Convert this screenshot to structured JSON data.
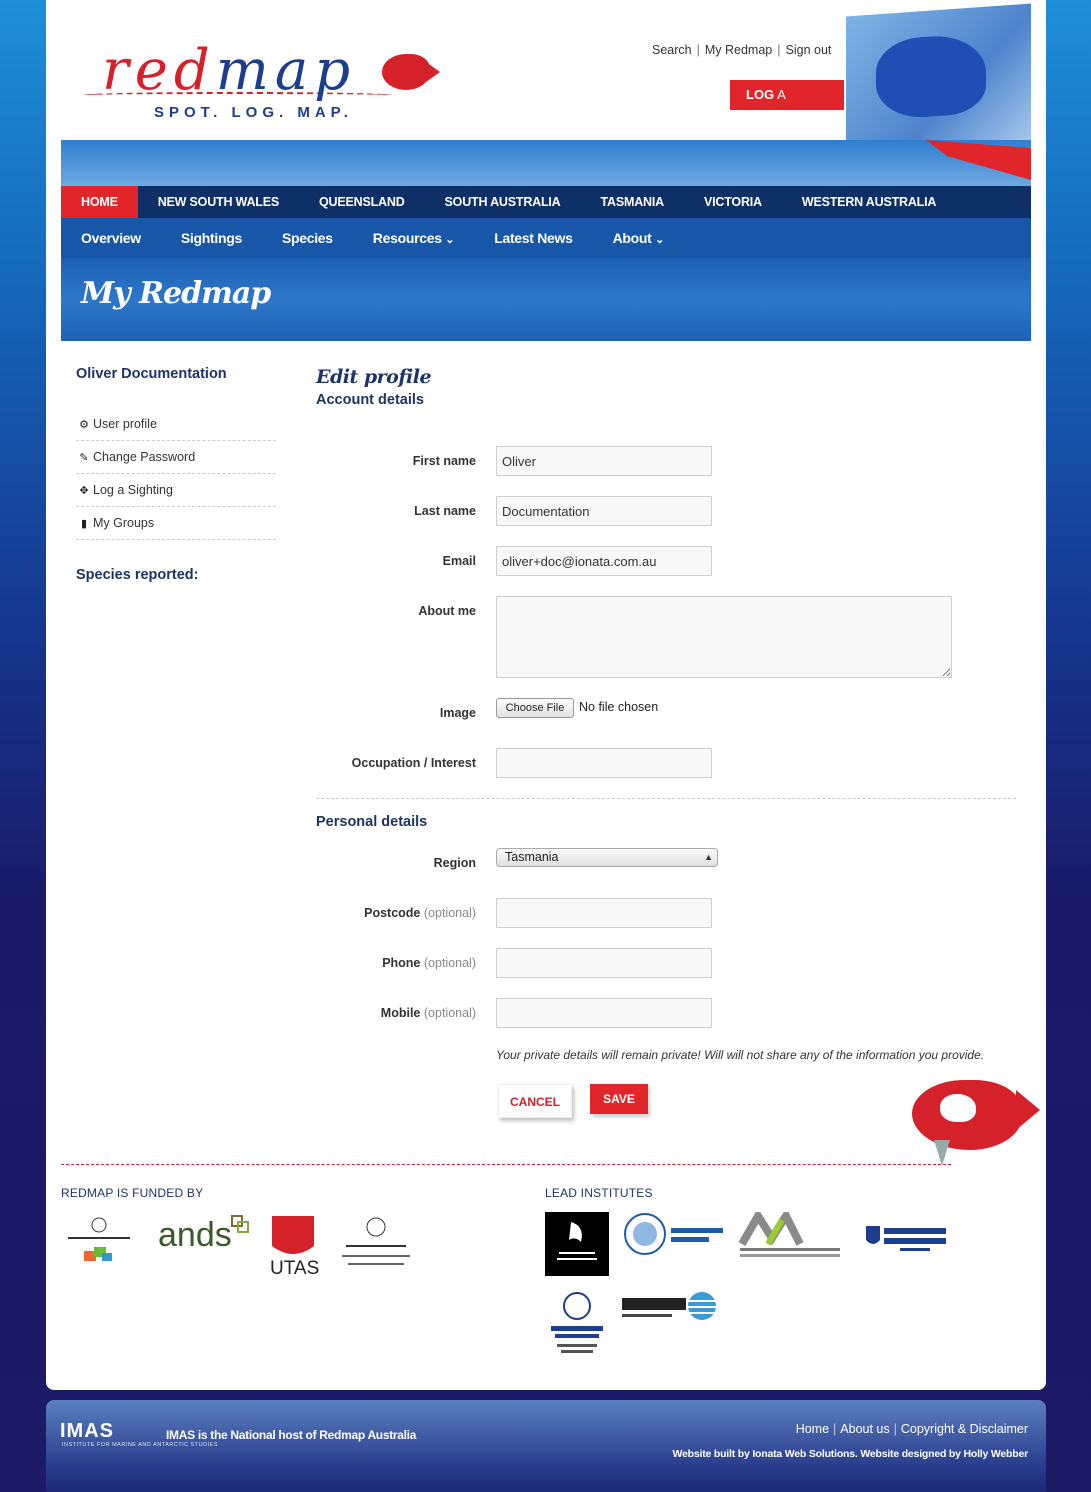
{
  "header": {
    "logo_word_red": "red",
    "logo_word_blue": "map",
    "tagline": "SPOT. LOG. MAP.",
    "top_links": [
      "Search",
      "My Redmap",
      "Sign out"
    ],
    "log_button_bold": "LOG",
    "log_button_rest": " A SIGHTING"
  },
  "nav_regions": [
    "HOME",
    "NEW SOUTH WALES",
    "QUEENSLAND",
    "SOUTH AUSTRALIA",
    "TASMANIA",
    "VICTORIA",
    "WESTERN AUSTRALIA"
  ],
  "nav_sub": [
    {
      "label": "Overview",
      "caret": ""
    },
    {
      "label": "Sightings",
      "caret": ""
    },
    {
      "label": "Species",
      "caret": ""
    },
    {
      "label": "Resources",
      "caret": "⌄"
    },
    {
      "label": "Latest News",
      "caret": ""
    },
    {
      "label": "About",
      "caret": "⌄"
    }
  ],
  "banner_title": "My Redmap",
  "sidebar": {
    "user_name": "Oliver Documentation",
    "items": [
      {
        "label": "User profile",
        "icon": "⚙"
      },
      {
        "label": "Change Password",
        "icon": "✎"
      },
      {
        "label": "Log a Sighting",
        "icon": "✥"
      },
      {
        "label": "My Groups",
        "icon": "▮"
      }
    ],
    "species_title": "Species reported:"
  },
  "form": {
    "title": "Edit profile",
    "account_section": "Account details",
    "first_name_label": "First name",
    "first_name_value": "Oliver",
    "last_name_label": "Last name",
    "last_name_value": "Documentation",
    "email_label": "Email",
    "email_value": "oliver+doc@ionata.com.au",
    "about_label": "About me",
    "image_label": "Image",
    "choose_file": "Choose File",
    "no_file": "No file chosen",
    "occupation_label": "Occupation / Interest",
    "personal_section": "Personal details",
    "region_label": "Region",
    "region_value": "Tasmania",
    "postcode_label": "Postcode",
    "phone_label": "Phone",
    "mobile_label": "Mobile",
    "optional": "(optional)",
    "privacy_note": "Your private details will remain private! Will will not share any of the information you provide.",
    "cancel": "CANCEL",
    "save": "SAVE"
  },
  "sponsors": {
    "funded_title": "REDMAP IS FUNDED BY",
    "lead_title": "LEAD INSTITUTES"
  },
  "footer": {
    "logo": "IMAS",
    "logo_sub": "INSTITUTE FOR MARINE AND ANTARCTIC STUDIES",
    "host_text": "IMAS is the National host of Redmap Australia",
    "links": [
      "Home",
      "About us",
      "Copyright & Disclaimer"
    ],
    "credit": "Website built by Ionata Web Solutions. Website designed by Holly Webber"
  },
  "colors": {
    "brand_red": "#e0262a",
    "brand_navy": "#0f2f67",
    "nav_blue": "#1857a8",
    "heading_blue": "#1c3466"
  }
}
